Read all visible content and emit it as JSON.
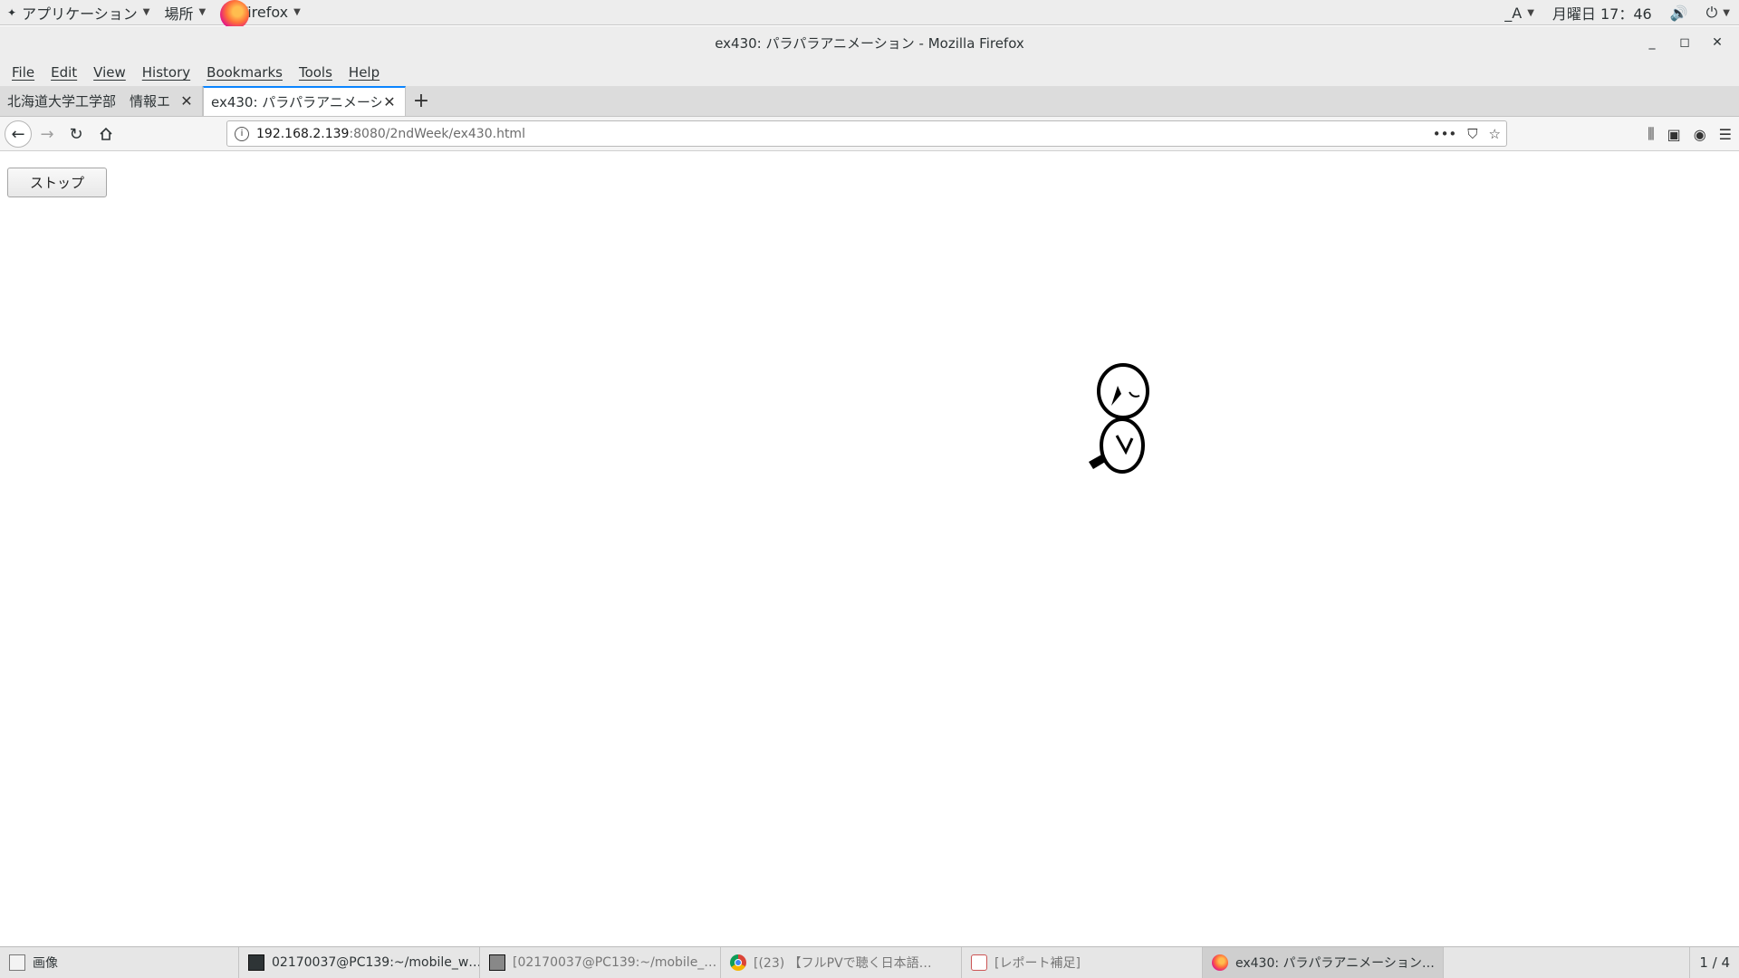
{
  "top_bar": {
    "applications_label": "アプリケーション",
    "places_label": "場所",
    "app_label": "Firefox",
    "input_method": "_A",
    "clock": "月曜日 17：46"
  },
  "window": {
    "title": "ex430: パラパラアニメーション - Mozilla Firefox"
  },
  "menu": {
    "items": [
      "File",
      "Edit",
      "View",
      "History",
      "Bookmarks",
      "Tools",
      "Help"
    ]
  },
  "tabs": [
    {
      "title": "北海道大学工学部　情報エ",
      "active": false
    },
    {
      "title": "ex430: パラパラアニメーシ",
      "active": true
    }
  ],
  "url": {
    "host": "192.168.2.139",
    "path": ":8080/2ndWeek/ex430.html"
  },
  "page": {
    "stop_button_label": "ストップ"
  },
  "taskbar": {
    "items": [
      {
        "label": "画像",
        "icon": "image-viewer-icon"
      },
      {
        "label": "02170037@PC139:~/mobile_w…",
        "icon": "terminal-icon"
      },
      {
        "label": "[02170037@PC139:~/mobile_…",
        "icon": "terminal-icon"
      },
      {
        "label": "[(23) 【フルPVで聴く日本語…",
        "icon": "chrome-icon"
      },
      {
        "label": "[レポート補足]",
        "icon": "document-icon"
      },
      {
        "label": "ex430: パラパラアニメーション…",
        "icon": "firefox-icon"
      }
    ],
    "workspace": "1 / 4"
  },
  "colors": {
    "accent": "#0a84ff",
    "chrome_bg": "#ededed"
  }
}
